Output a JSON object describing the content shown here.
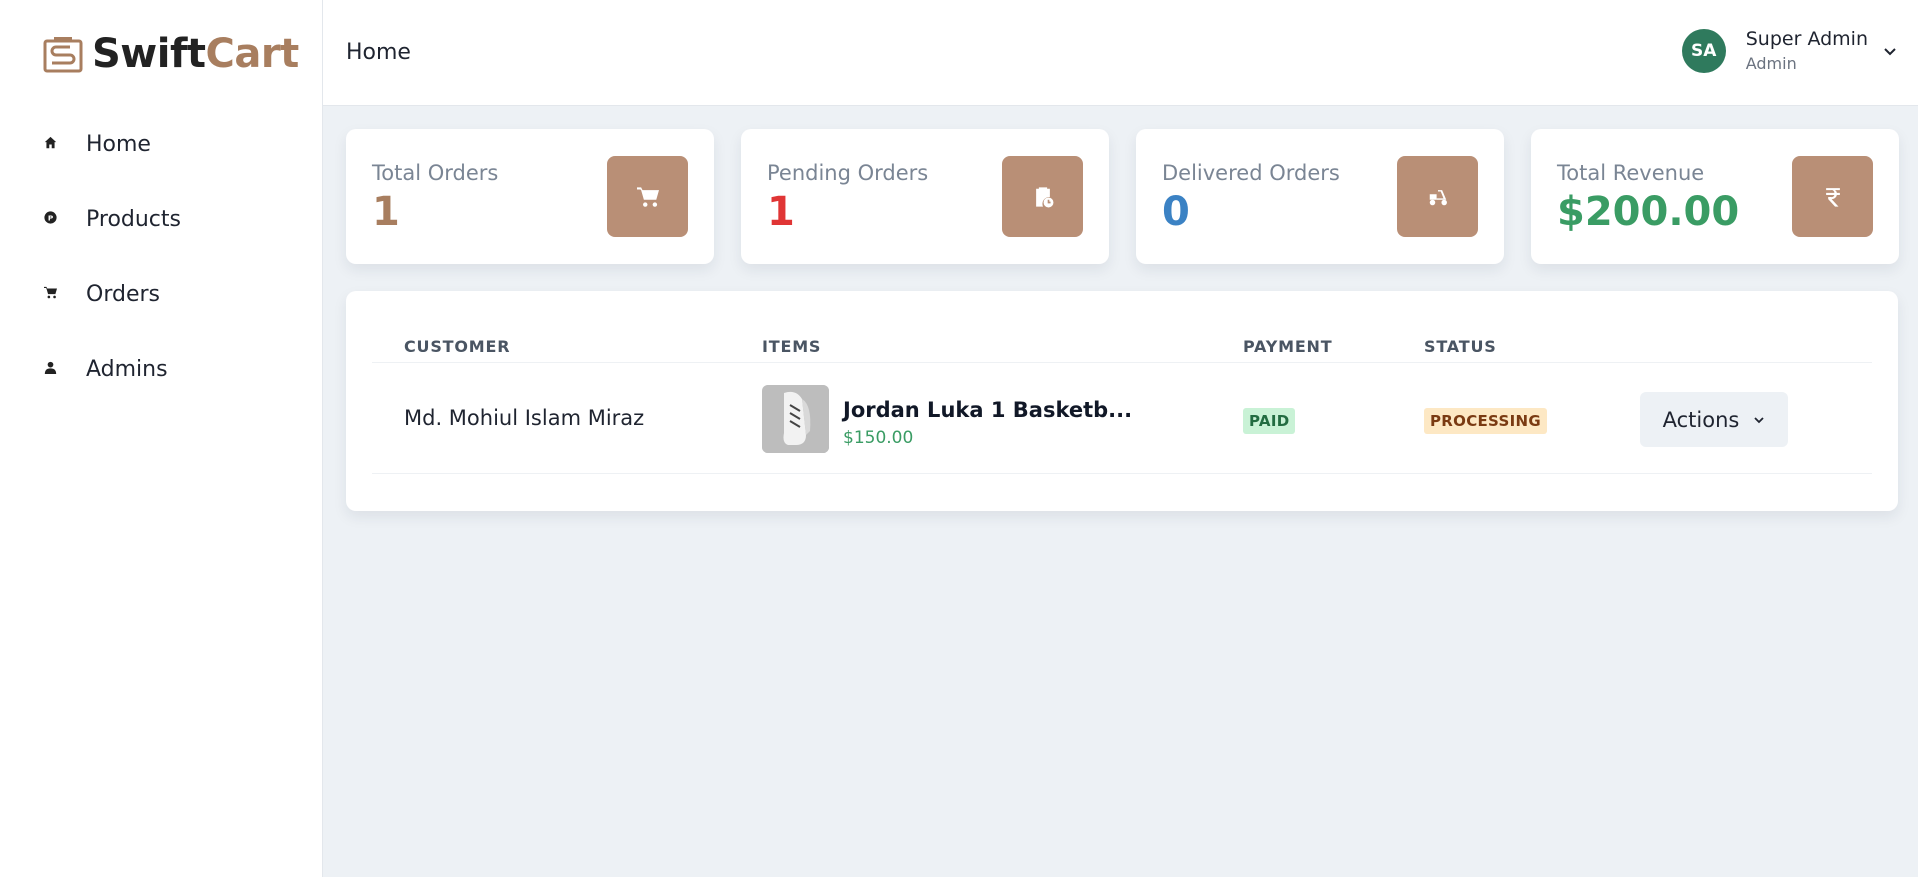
{
  "brand": {
    "part1": "Swift",
    "part2": "Cart"
  },
  "sidebar": {
    "items": [
      {
        "label": "Home",
        "icon": "home-icon"
      },
      {
        "label": "Products",
        "icon": "product-icon"
      },
      {
        "label": "Orders",
        "icon": "cart-icon"
      },
      {
        "label": "Admins",
        "icon": "user-icon"
      }
    ]
  },
  "header": {
    "title": "Home",
    "user": {
      "initials": "SA",
      "name": "Super Admin",
      "role": "Admin"
    }
  },
  "stats": [
    {
      "label": "Total Orders",
      "value": "1",
      "color": "#a87e5f",
      "icon": "cart-icon"
    },
    {
      "label": "Pending Orders",
      "value": "1",
      "color": "#e03535",
      "icon": "clipboard-clock-icon"
    },
    {
      "label": "Delivered Orders",
      "value": "0",
      "color": "#3b82c4",
      "icon": "delivery-scooter-icon"
    },
    {
      "label": "Total Revenue",
      "value": "$200.00",
      "color": "#3a9c64",
      "icon": "rupee-icon"
    }
  ],
  "table": {
    "headers": [
      "CUSTOMER",
      "ITEMS",
      "PAYMENT",
      "STATUS"
    ],
    "rows": [
      {
        "customer": "Md. Mohiul Islam Miraz",
        "item_name": "Jordan Luka 1 Basketb...",
        "item_price": "$150.00",
        "payment": "PAID",
        "status": "PROCESSING",
        "action_label": "Actions"
      }
    ]
  }
}
